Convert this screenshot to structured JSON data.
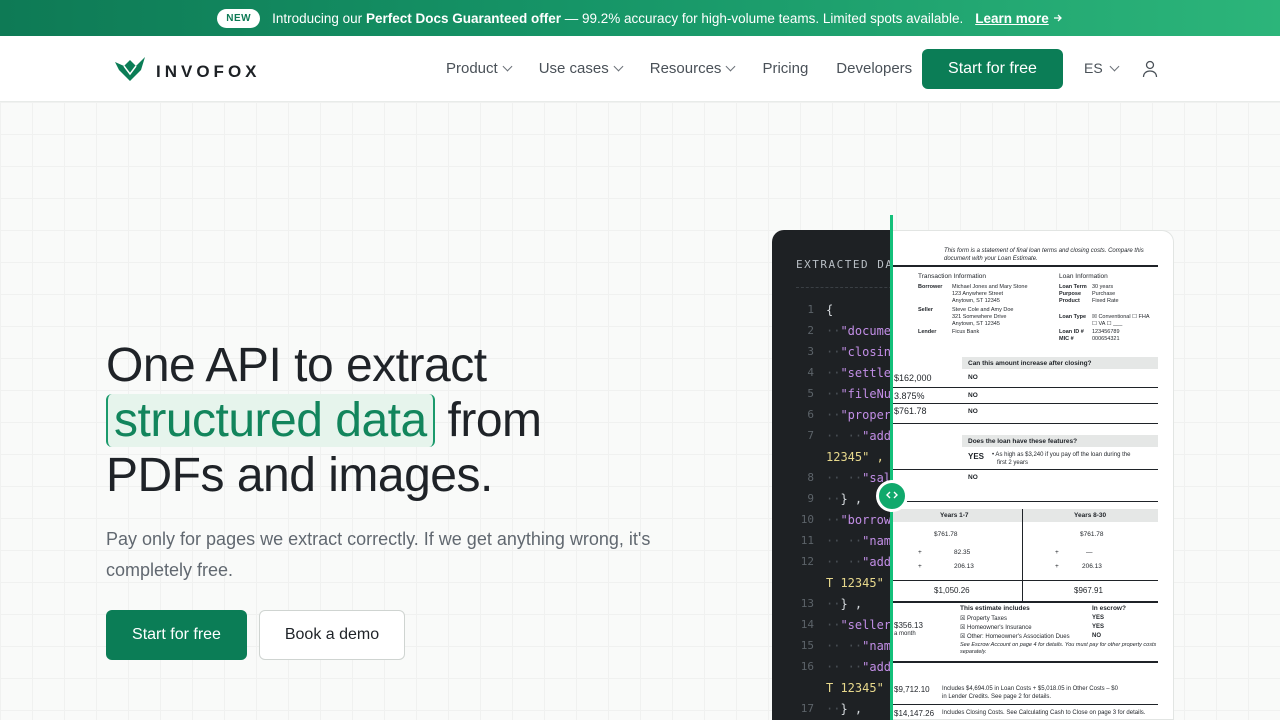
{
  "announcement": {
    "badge": "NEW",
    "intro": "Introducing our",
    "offer": "Perfect Docs Guaranteed offer",
    "rest": "— 99.2% accuracy for high-volume teams. Limited spots available.",
    "learn_more": "Learn more"
  },
  "brand": {
    "name": "INVOFOX",
    "accent": "#0b7d56"
  },
  "nav": {
    "items": [
      {
        "label": "Product",
        "dropdown": true
      },
      {
        "label": "Use cases",
        "dropdown": true
      },
      {
        "label": "Resources",
        "dropdown": true
      },
      {
        "label": "Pricing",
        "dropdown": false
      },
      {
        "label": "Developers",
        "dropdown": false
      }
    ],
    "cta": "Start for free",
    "language": "ES"
  },
  "hero": {
    "title_line1": "One API to extract",
    "title_highlight": "structured data",
    "title_from": "from",
    "title_line3": "PDFs and images.",
    "subtitle": "Pay only for pages we extract correctly. If we get anything wrong, it's completely free.",
    "primary_button": "Start for free",
    "secondary_button": "Book a demo"
  },
  "code_panel": {
    "header": "EXTRACTED DATA",
    "lines": [
      {
        "n": "1",
        "text": "{"
      },
      {
        "n": "2",
        "text": "\"docume"
      },
      {
        "n": "3",
        "text": "\"closin"
      },
      {
        "n": "4",
        "text": "\"settle"
      },
      {
        "n": "5",
        "text": "\"fileNu"
      },
      {
        "n": "6",
        "text": "\"proper"
      },
      {
        "n": "7",
        "text": "\"addr"
      },
      {
        "n": "",
        "text": "12345\" ,"
      },
      {
        "n": "8",
        "text": "\"sal"
      },
      {
        "n": "9",
        "text": "} ,"
      },
      {
        "n": "10",
        "text": "\"borrow"
      },
      {
        "n": "11",
        "text": "\"name"
      },
      {
        "n": "12",
        "text": "\"addr"
      },
      {
        "n": "",
        "text": "T 12345\""
      },
      {
        "n": "13",
        "text": "} ,"
      },
      {
        "n": "14",
        "text": "\"seller"
      },
      {
        "n": "15",
        "text": "\"name"
      },
      {
        "n": "16",
        "text": "\"addr"
      },
      {
        "n": "",
        "text": "T 12345\""
      },
      {
        "n": "17",
        "text": "} ,"
      }
    ]
  },
  "document": {
    "intro": "This form is a statement of final loan terms and closing costs. Compare this document with your Loan Estimate.",
    "transaction_info": "Transaction Information",
    "borrower_label": "Borrower",
    "borrower": [
      "Michael Jones and Mary Stone",
      "123 Anywhere Street",
      "Anytown, ST 12345"
    ],
    "seller_label": "Seller",
    "seller": [
      "Steve Cole and Amy Doe",
      "321 Somewhere Drive",
      "Anytown, ST 12345"
    ],
    "lender_label": "Lender",
    "lender": "Ficus Bank",
    "loan_info": "Loan Information",
    "loan_term_label": "Loan Term",
    "loan_term": "30 years",
    "purpose_label": "Purpose",
    "purpose": "Purchase",
    "product_label": "Product",
    "product": "Fixed Rate",
    "loan_type_label": "Loan Type",
    "loan_type_opts": "☒ Conventional  ☐ FHA",
    "loan_type_opts2": "☐ VA  ☐ ___",
    "loan_id_label": "Loan ID #",
    "loan_id": "123456789",
    "mic_label": "MIC #",
    "mic": "000654321",
    "q_increase": "Can this amount increase after closing?",
    "amount1": "$162,000",
    "amount2": "3.875%",
    "amount3": "$761.78",
    "no": "NO",
    "q_features": "Does the loan have these features?",
    "yes": "YES",
    "feature_text1": "• As high as $3,240 if you pay off the loan during the",
    "feature_text2": "first 2 years",
    "years_1_7": "Years 1-7",
    "years_8_30": "Years 8-30",
    "pay_a1": "$761.78",
    "pay_b1": "$761.78",
    "pay_a2": "82.35",
    "pay_b2": "—",
    "pay_a3": "206.13",
    "pay_b3": "206.13",
    "plus": "+",
    "total_a": "$1,050.26",
    "total_b": "$967.91",
    "escrow_amt": "$356.13",
    "a_month": "a month",
    "estimate_includes": "This estimate includes",
    "in_escrow": "In escrow?",
    "prop_taxes": "☒ Property Taxes",
    "prop_taxes_v": "YES",
    "home_ins": "☒ Homeowner's Insurance",
    "home_ins_v": "YES",
    "other_hoa": "☒ Other: Homeowner's Association Dues",
    "other_hoa_v": "NO",
    "escrow_note": "See Escrow Account on page 4 for details. You must pay for other property costs separately.",
    "closing_amt": "$9,712.10",
    "closing_text1": "Includes $4,694.05 in Loan Costs + $5,018.05 in Other Costs – $0",
    "closing_text2": "in Lender Credits. See page 2 for details.",
    "cash_amt": "$14,147.26",
    "cash_text": "Includes Closing Costs. See Calculating Cash to Close on page 3 for details."
  }
}
